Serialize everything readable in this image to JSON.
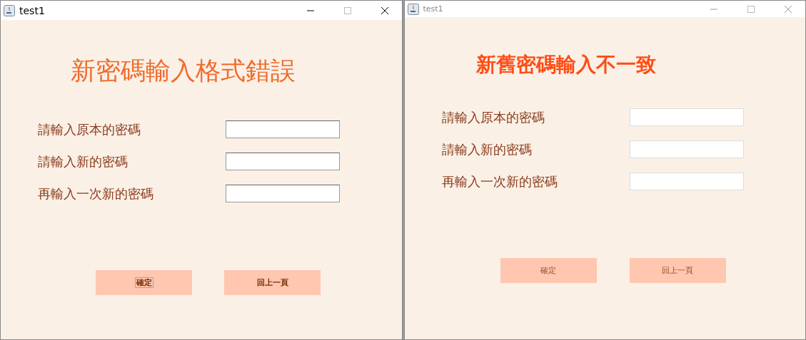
{
  "windows": [
    {
      "title": "test1",
      "active": true,
      "heading": "新密碼輸入格式錯誤",
      "fields": [
        {
          "label": "請輸入原本的密碼"
        },
        {
          "label": "請輸入新的密碼"
        },
        {
          "label": "再輸入一次新的密碼"
        }
      ],
      "buttons": [
        {
          "label": "確定",
          "focused": true
        },
        {
          "label": "回上一頁",
          "focused": false
        }
      ]
    },
    {
      "title": "test1",
      "active": false,
      "heading": "新舊密碼輸入不一致",
      "fields": [
        {
          "label": "請輸入原本的密碼"
        },
        {
          "label": "請輸入新的密碼"
        },
        {
          "label": "再輸入一次新的密碼"
        }
      ],
      "buttons": [
        {
          "label": "確定",
          "focused": false
        },
        {
          "label": "回上一頁",
          "focused": false
        }
      ]
    }
  ]
}
